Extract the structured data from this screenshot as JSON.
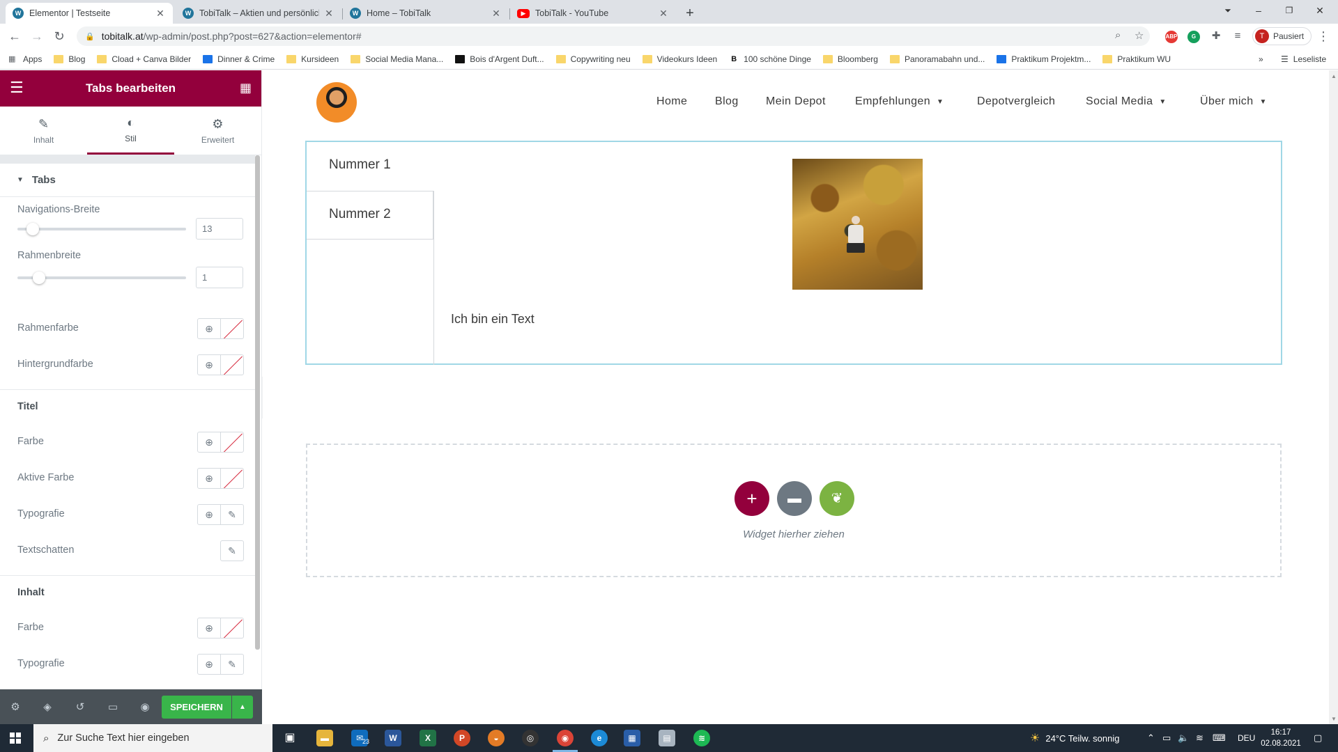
{
  "browser": {
    "tabs": [
      {
        "title": "Elementor | Testseite",
        "icon": "wordpress-icon",
        "active": true
      },
      {
        "title": "TobiTalk – Aktien und persönliche",
        "icon": "wordpress-icon",
        "active": false
      },
      {
        "title": "Home – TobiTalk",
        "icon": "wordpress-icon",
        "active": false
      },
      {
        "title": "TobiTalk - YouTube",
        "icon": "youtube-icon",
        "active": false
      }
    ],
    "url_domain": "tobitalk.at",
    "url_path": "/wp-admin/post.php?post=627&action=elementor#",
    "profile_initial": "T",
    "profile_status": "Pausiert",
    "bookmarks": [
      {
        "label": "Apps",
        "icon": "apps-grid-icon"
      },
      {
        "label": "Blog",
        "icon": "folder-icon"
      },
      {
        "label": "Cload + Canva Bilder",
        "icon": "folder-icon"
      },
      {
        "label": "Dinner & Crime",
        "icon": "site-icon"
      },
      {
        "label": "Kursideen",
        "icon": "folder-icon"
      },
      {
        "label": "Social Media Mana...",
        "icon": "folder-icon"
      },
      {
        "label": "Bois d'Argent Duft...",
        "icon": "site-icon"
      },
      {
        "label": "Copywriting neu",
        "icon": "folder-icon"
      },
      {
        "label": "Videokurs Ideen",
        "icon": "folder-icon"
      },
      {
        "label": "100 schöne Dinge",
        "icon": "site-icon"
      },
      {
        "label": "Bloomberg",
        "icon": "folder-icon"
      },
      {
        "label": "Panoramabahn und...",
        "icon": "folder-icon"
      },
      {
        "label": "Praktikum Projektm...",
        "icon": "site-icon"
      },
      {
        "label": "Praktikum WU",
        "icon": "folder-icon"
      }
    ],
    "reading_list": "Leseliste",
    "more_bookmarks": "»"
  },
  "panel": {
    "title": "Tabs bearbeiten",
    "tabs": [
      {
        "label": "Inhalt",
        "icon": "pencil-icon"
      },
      {
        "label": "Stil",
        "icon": "contrast-icon"
      },
      {
        "label": "Erweitert",
        "icon": "gear-icon"
      }
    ],
    "section_title": "Tabs",
    "nav_width_label": "Navigations-Breite",
    "nav_width_value": "13",
    "nav_width_fraction": 0.06,
    "border_width_label": "Rahmenbreite",
    "border_width_value": "1",
    "border_width_fraction": 0.1,
    "border_color_label": "Rahmenfarbe",
    "background_color_label": "Hintergrundfarbe",
    "title_group": "Titel",
    "title_color_label": "Farbe",
    "title_active_color_label": "Aktive Farbe",
    "title_typography_label": "Typografie",
    "title_text_shadow_label": "Textschatten",
    "content_group": "Inhalt",
    "content_color_label": "Farbe",
    "content_typography_label": "Typografie",
    "save_label": "SPEICHERN"
  },
  "site": {
    "nav": [
      {
        "label": "Home"
      },
      {
        "label": "Blog"
      },
      {
        "label": "Mein Depot"
      },
      {
        "label": "Empfehlungen",
        "dropdown": true
      },
      {
        "label": "Depotvergleich"
      },
      {
        "label": "Social Media",
        "dropdown": true
      },
      {
        "label": "Über mich",
        "dropdown": true
      }
    ],
    "tabs_widget": {
      "tab1": "Nummer 1",
      "tab2": "Nummer 2",
      "content_text": "Ich bin ein Text"
    },
    "dropzone_label": "Widget hierher ziehen"
  },
  "taskbar": {
    "search_placeholder": "Zur Suche Text hier eingeben",
    "weather": "24°C  Teilw. sonnig",
    "language": "DEU",
    "time": "16:17",
    "date": "02.08.2021",
    "mail_badge": "23"
  },
  "colors": {
    "elementor_brand": "#93003c",
    "save_green": "#39b54a",
    "widget_border": "#a0d7e6",
    "dz_plus": "#93003c",
    "dz_folder": "#6d7882",
    "dz_kit": "#7cb342"
  }
}
